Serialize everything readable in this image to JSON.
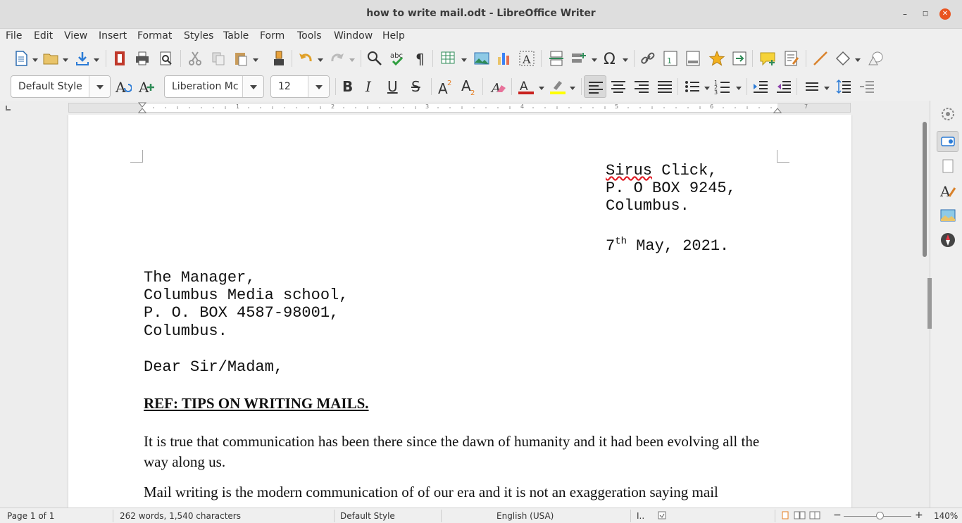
{
  "window": {
    "title": "how to write mail.odt - LibreOffice Writer"
  },
  "menu": [
    "File",
    "Edit",
    "View",
    "Insert",
    "Format",
    "Styles",
    "Table",
    "Form",
    "Tools",
    "Window",
    "Help"
  ],
  "formatting": {
    "paragraph_style": "Default Style",
    "font_name": "Liberation Mc",
    "font_size": "12"
  },
  "document": {
    "sender": [
      "Sirus Click,",
      "P. O BOX 9245,",
      "Columbus."
    ],
    "date_day": "7",
    "date_sup": "th",
    "date_rest": " May, 2021.",
    "recipient": [
      "The Manager,",
      "Columbus Media school,",
      "P. O. BOX 4587-98001,",
      "Columbus."
    ],
    "salutation": "Dear Sir/Madam,",
    "ref": "REF: TIPS ON WRITING MAILS.",
    "para1": "It is true that communication has been there since the dawn of humanity and it had been evolving all the way along us.",
    "para2": "Mail writing is the modern communication of of our era and it is not an exaggeration saying mail"
  },
  "ruler_numbers": [
    "1",
    "2",
    "3",
    "4",
    "5",
    "6",
    "7"
  ],
  "status": {
    "page": "Page 1 of 1",
    "words": "262 words, 1,540 characters",
    "style": "Default Style",
    "language": "English (USA)",
    "zoom": "140%"
  }
}
